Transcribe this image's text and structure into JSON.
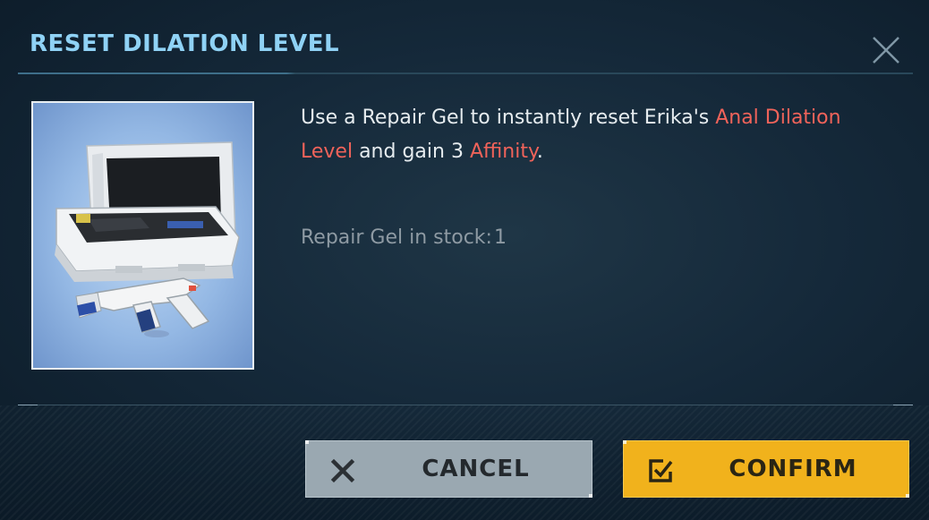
{
  "dialog": {
    "title": "RESET DILATION LEVEL",
    "close_icon": "close-icon"
  },
  "item": {
    "image_icon": "repair-gel-kit-image"
  },
  "description": {
    "part1": "Use a Repair Gel to instantly reset Erika's ",
    "highlight1": "Anal Dilation Level",
    "part2": " and gain 3 ",
    "highlight2": "Affinity",
    "part3": "."
  },
  "stock": {
    "label": "Repair Gel in stock:",
    "value": "1"
  },
  "buttons": {
    "cancel_label": "CANCEL",
    "cancel_icon": "x-icon",
    "confirm_label": "CONFIRM",
    "confirm_icon": "checkbox-icon"
  },
  "colors": {
    "title": "#8fd2f5",
    "highlight": "#f0635a",
    "cancel_bg": "#9aa8b1",
    "confirm_bg": "#f1b21c"
  }
}
